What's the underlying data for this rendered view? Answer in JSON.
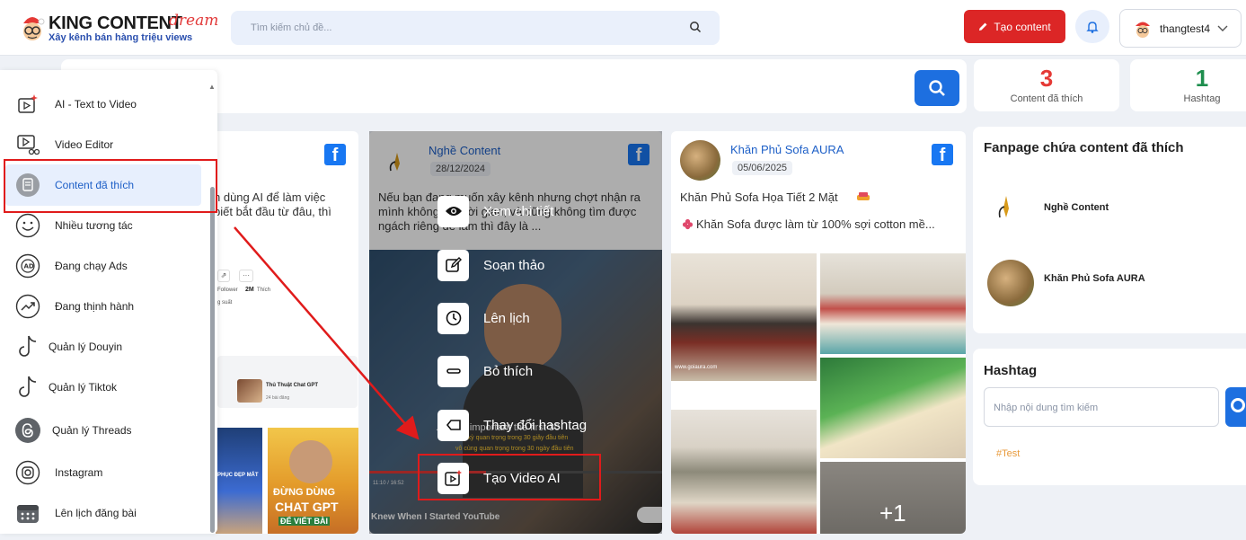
{
  "header": {
    "logo_title": "KING CONTENT",
    "logo_script": "dream",
    "logo_tagline": "Xây kênh bán hàng triệu views",
    "search_placeholder": "Tìm kiếm chủ đề...",
    "create_label": "Tạo content",
    "username": "thangtest4"
  },
  "stats": [
    {
      "value": "3",
      "label": "Content đã thích",
      "color": "#e53935"
    },
    {
      "value": "1",
      "label": "Hashtag",
      "color": "#1e8e4e"
    }
  ],
  "sidebar": {
    "items": [
      {
        "label": "AI - Text to Video"
      },
      {
        "label": "Video Editor"
      },
      {
        "label": "Content đã thích"
      },
      {
        "label": "Nhiều tương tác"
      },
      {
        "label": "Đang chạy Ads"
      },
      {
        "label": "Đang thịnh hành"
      },
      {
        "label": "Quản lý Douyin"
      },
      {
        "label": "Quản lý Tiktok"
      },
      {
        "label": "Quản lý Threads"
      },
      {
        "label": "Instagram"
      },
      {
        "label": "Lên lịch đăng bài"
      }
    ]
  },
  "cards": [
    {
      "text": "n dùng AI để làm việc\nbiết bắt đầu từ đâu, thì",
      "stat_follower": "Follower",
      "stat_count": "2M",
      "stat_like": "Thích",
      "stat_extra": "g suất",
      "sub_title": "Thủ Thuật Chat GPT",
      "sub_meta": "24 bài đăng",
      "thumb_text_top": "PHỤC ĐẸP MẮT",
      "thumb_text_1": "ĐỪNG DÙNG",
      "thumb_text_2": "CHAT GPT",
      "thumb_text_3": "ĐỂ VIẾT BÀI"
    },
    {
      "page_name": "Nghề Content",
      "date": "28/12/2024",
      "text": "Nếu bạn đang muốn xây kênh nhưng chợt nhận ra mình không có thời gian, và cũng không tìm được ngách riêng để làm thì đây là ...",
      "video_caption": "Knew When I Started YouTube",
      "video_sub_1": "...ously important the first 30",
      "video_sub_2": "cực kỳ quan trọng trong 30 giây đầu tiên",
      "video_sub_3": "vô cùng quan trọng trong 30 ngày đầu tiên",
      "video_time": "11:10 / 16:52"
    },
    {
      "page_name": "Khăn Phủ Sofa AURA",
      "date": "05/06/2025",
      "title": "Khăn Phủ Sofa Họa Tiết 2 Mặt",
      "text": "Khăn Sofa được làm từ 100% sợi cotton mề...",
      "more": "+1",
      "watermark": "www.goiaura.com"
    }
  ],
  "overlay_menu": [
    {
      "label": "Xem chi tiết",
      "icon": "eye-icon"
    },
    {
      "label": "Soạn thảo",
      "icon": "edit-icon"
    },
    {
      "label": "Lên lịch",
      "icon": "clock-icon"
    },
    {
      "label": "Bỏ thích",
      "icon": "minus-icon"
    },
    {
      "label": "Thay đổi hashtag",
      "icon": "tag-icon"
    },
    {
      "label": "Tạo Video AI",
      "icon": "ai-video-icon"
    }
  ],
  "fanpage": {
    "title": "Fanpage chứa content đã thích",
    "pages": [
      {
        "name": "Nghề Content"
      },
      {
        "name": "Khăn Phủ Sofa AURA"
      }
    ]
  },
  "hashtag": {
    "title": "Hashtag",
    "input_placeholder": "Nhập nội dung tìm kiếm",
    "tags": [
      "#Test"
    ]
  },
  "colors": {
    "primary": "#1d6fe0",
    "danger": "#dc2626",
    "highlight": "#e01b1b"
  }
}
